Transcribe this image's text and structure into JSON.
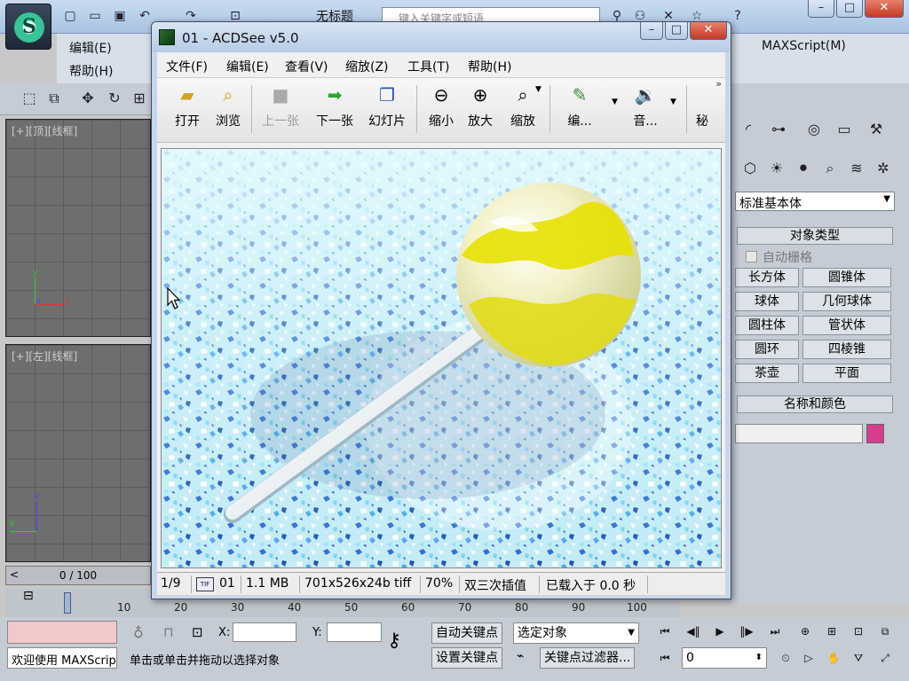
{
  "max": {
    "doc_title": "无标题",
    "search_placeholder": "键入关键字或短语",
    "menu": {
      "edit": "编辑(E)",
      "help": "帮助(H)",
      "maxscript": "MAXScript(M)"
    },
    "viewport_top_label": "[+][顶][线框]",
    "viewport_left_label": "[+][左][线框]",
    "timeline": "0 / 100",
    "ruler_ticks": [
      "10",
      "20",
      "30",
      "40",
      "50",
      "60",
      "70",
      "80",
      "90",
      "100"
    ],
    "command_panel": {
      "dropdown_value": "标准基本体",
      "rollout_object_type": "对象类型",
      "auto_grid": "自动栅格",
      "primitives": [
        "长方体",
        "圆锥体",
        "球体",
        "几何球体",
        "圆柱体",
        "管状体",
        "圆环",
        "四棱锥",
        "茶壶",
        "平面"
      ],
      "rollout_name_color": "名称和颜色",
      "swatch_color": "#d63d8f"
    },
    "status": {
      "welcome": "欢迎使用 MAXScript。",
      "prompt": "单击或单击并拖动以选择对象",
      "x_label": "X:",
      "y_label": "Y:",
      "auto_key": "自动关键点",
      "set_key": "设置关键点",
      "selected_object": "选定对象",
      "key_filters": "关键点过滤器...",
      "frame_value": "0"
    }
  },
  "acdsee": {
    "title": "01 - ACDSee v5.0",
    "menu": [
      "文件(F)",
      "编辑(E)",
      "查看(V)",
      "缩放(Z)",
      "工具(T)",
      "帮助(H)"
    ],
    "toolbar": {
      "open": "打开",
      "browse": "浏览",
      "prev": "上一张",
      "next": "下一张",
      "slideshow": "幻灯片",
      "zoom_out": "缩小",
      "zoom_in": "放大",
      "zoom": "缩放",
      "edit": "编...",
      "audio": "音...",
      "more": "秘"
    },
    "status": {
      "index": "1/9",
      "name": "01",
      "size": "1.1 MB",
      "dims": "701x526x24b tiff",
      "zoom": "70%",
      "interp": "双三次插值",
      "load": "已载入于 0.0 秒"
    }
  }
}
